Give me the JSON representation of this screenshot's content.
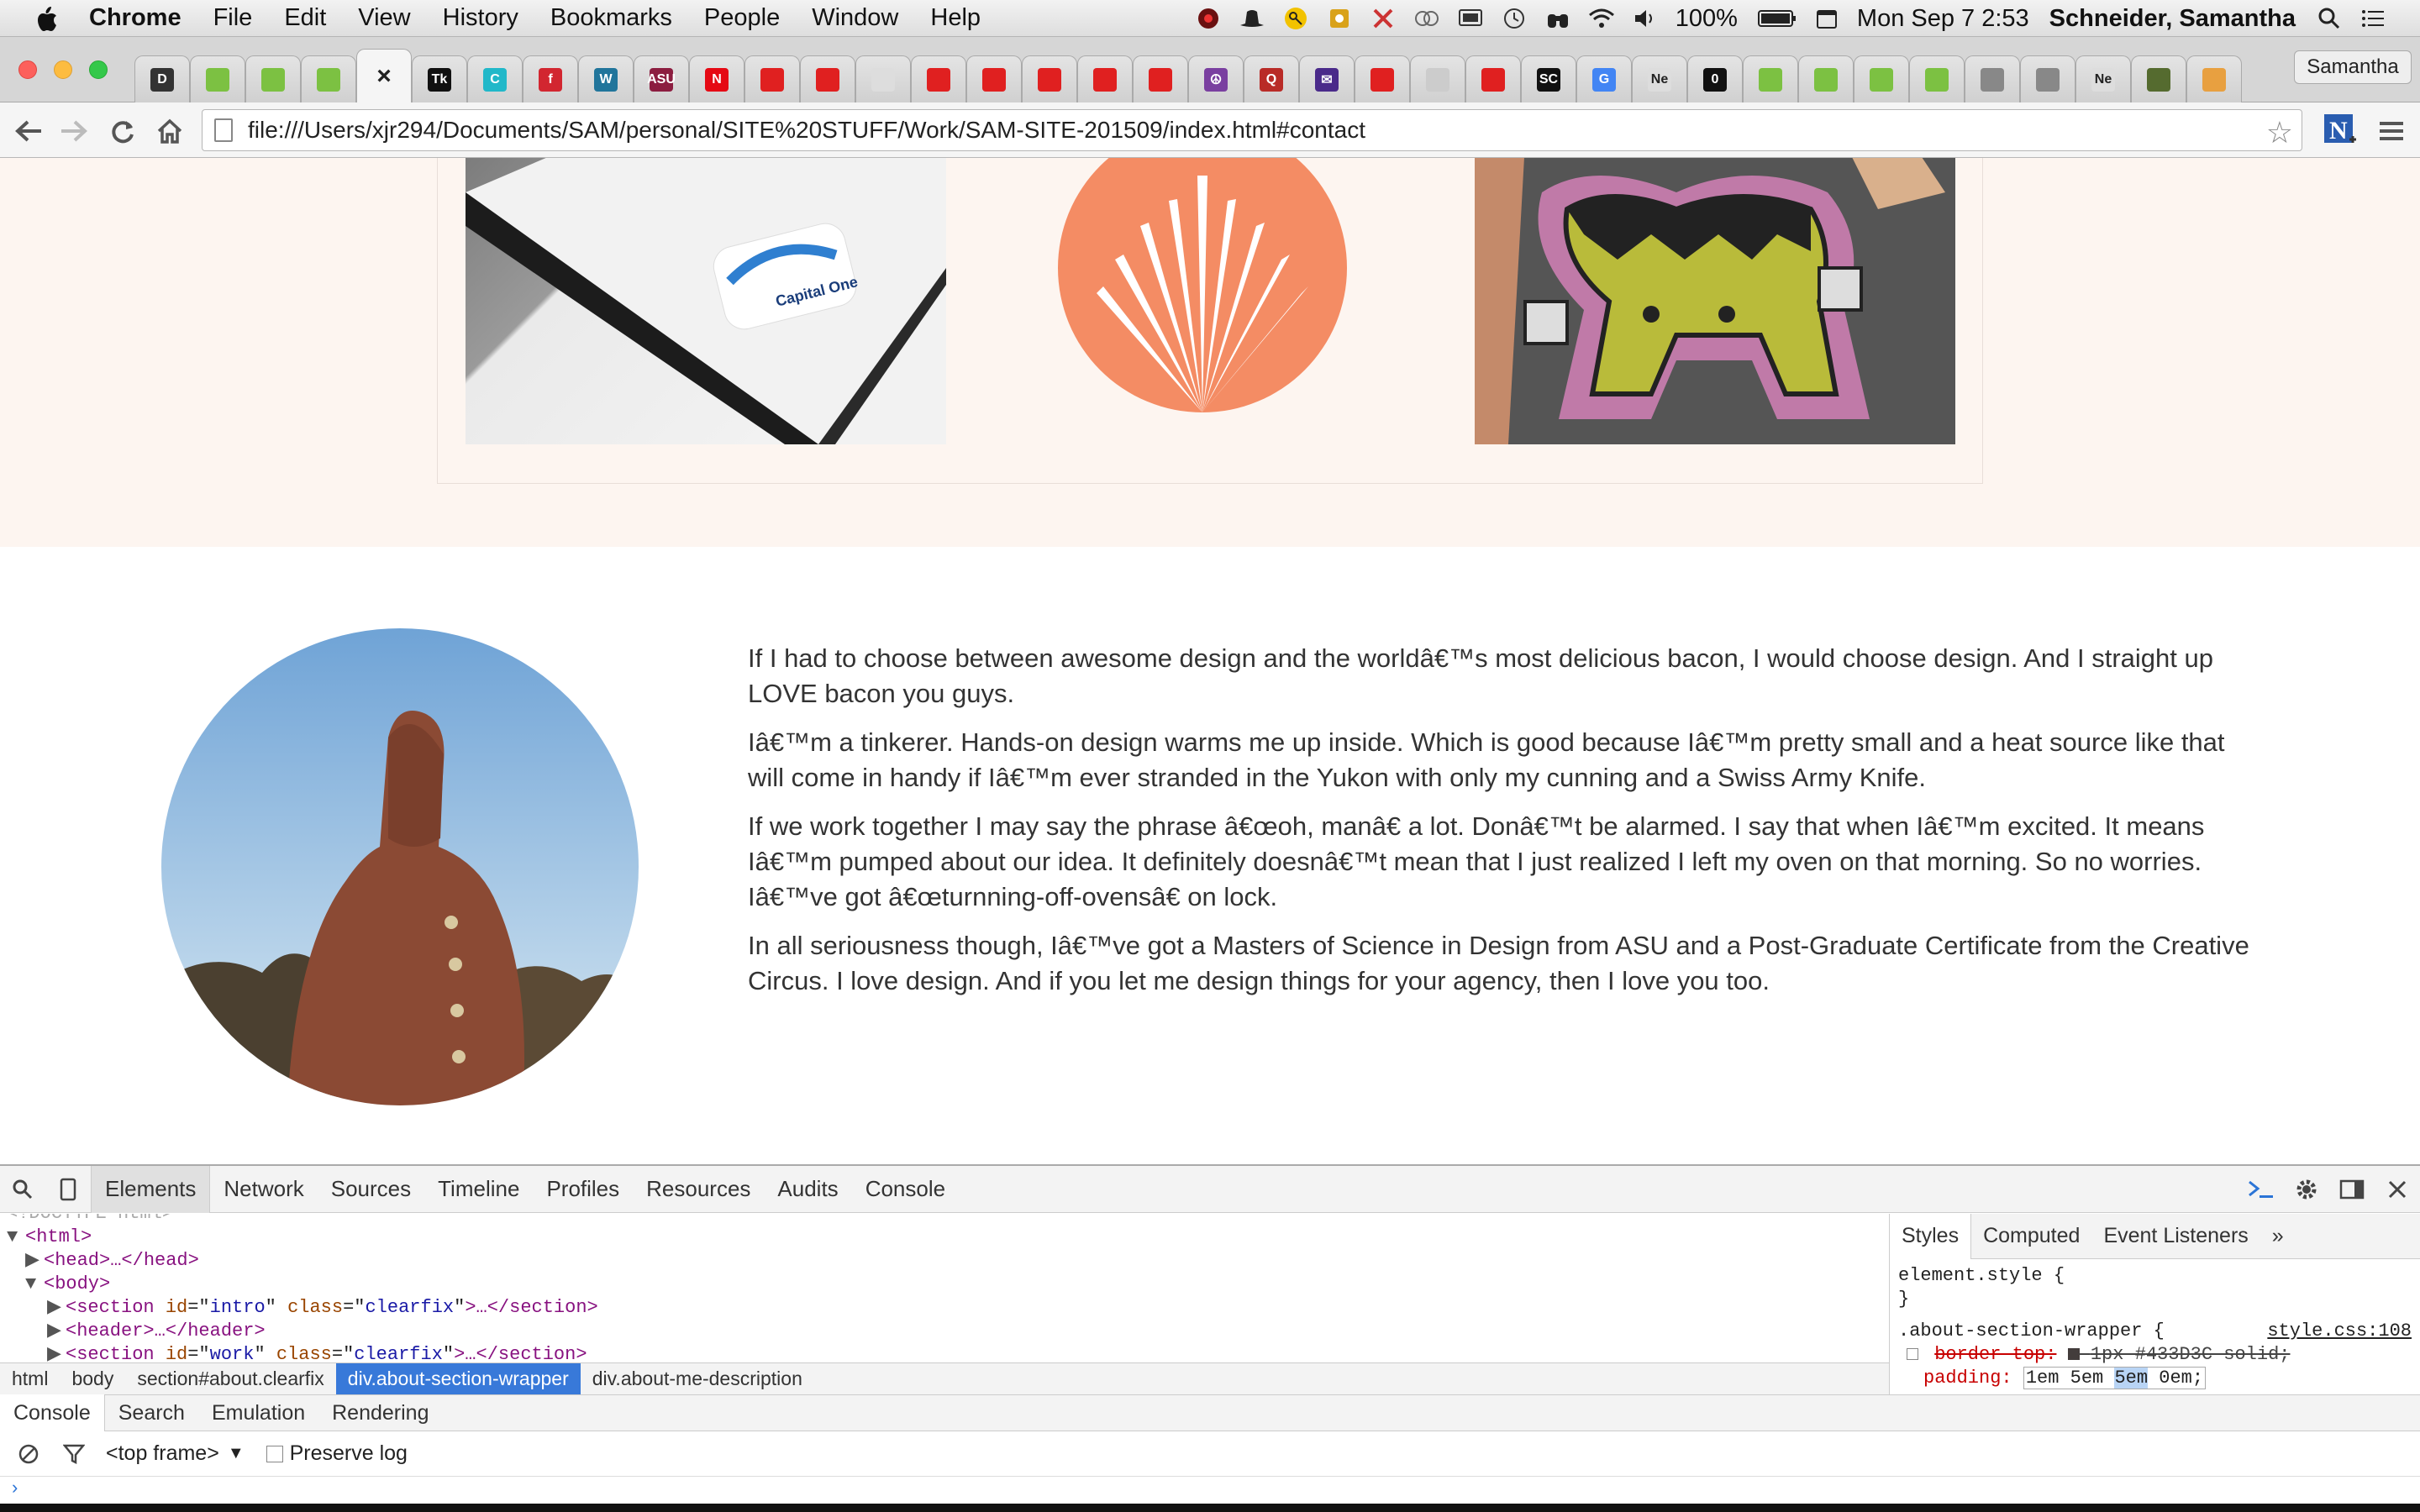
{
  "menubar": {
    "app": "Chrome",
    "items": [
      "File",
      "Edit",
      "View",
      "History",
      "Bookmarks",
      "People",
      "Window",
      "Help"
    ],
    "battery": "100%",
    "datetime": "Mon Sep 7  2:53",
    "user": "Schneider, Samantha"
  },
  "tabs": {
    "favicons": [
      {
        "label": "D",
        "color": "#333333"
      },
      {
        "label": "",
        "color": "#7cc142"
      },
      {
        "label": "",
        "color": "#7cc142"
      },
      {
        "label": "",
        "color": "#7cc142"
      },
      {
        "label": "×",
        "color": "#f5f5f5",
        "active": true
      },
      {
        "label": "Tk",
        "color": "#111111"
      },
      {
        "label": "C",
        "color": "#21b8c9"
      },
      {
        "label": "f",
        "color": "#d22630"
      },
      {
        "label": "W",
        "color": "#21759b"
      },
      {
        "label": "ASU",
        "color": "#8c1d40"
      },
      {
        "label": "N",
        "color": "#e50914"
      },
      {
        "label": "",
        "color": "#e02020"
      },
      {
        "label": "",
        "color": "#e02020"
      },
      {
        "label": "",
        "color": "#dddddd"
      },
      {
        "label": "",
        "color": "#e02020"
      },
      {
        "label": "",
        "color": "#e02020"
      },
      {
        "label": "",
        "color": "#e02020"
      },
      {
        "label": "",
        "color": "#e02020"
      },
      {
        "label": "",
        "color": "#e02020"
      },
      {
        "label": "☮",
        "color": "#7a3fa0"
      },
      {
        "label": "Q",
        "color": "#b92b27"
      },
      {
        "label": "✉",
        "color": "#4a2a8a"
      },
      {
        "label": "",
        "color": "#e02020"
      },
      {
        "label": "",
        "color": "#cccccc"
      },
      {
        "label": "",
        "color": "#e02020"
      },
      {
        "label": "SC",
        "color": "#111111"
      },
      {
        "label": "G",
        "color": "#4285f4"
      },
      {
        "label": "Ne",
        "color": "#dddddd"
      },
      {
        "label": "0",
        "color": "#111111"
      },
      {
        "label": "",
        "color": "#7cc142"
      },
      {
        "label": "",
        "color": "#7cc142"
      },
      {
        "label": "",
        "color": "#7cc142"
      },
      {
        "label": "",
        "color": "#7cc142"
      },
      {
        "label": "",
        "color": "#888888"
      },
      {
        "label": "",
        "color": "#888888"
      },
      {
        "label": "Ne",
        "color": "#dddddd"
      },
      {
        "label": "",
        "color": "#556b2f"
      },
      {
        "label": "",
        "color": "#e8a040"
      }
    ],
    "profile": "Samantha"
  },
  "toolbar": {
    "url": "file:///Users/xjr294/Documents/SAM/personal/SITE%20STUFF/Work/SAM-SITE-201509/index.html#contact"
  },
  "about": {
    "paragraphs": [
      "If I had to choose between awesome design and the worldâ€™s most delicious bacon, I would choose design. And I straight up LOVE bacon you guys.",
      "Iâ€™m a tinkerer. Hands-on design warms me up inside. Which is good because Iâ€™m pretty small and a heat source like that will come in handy if Iâ€™m ever stranded in the Yukon with only my cunning and a Swiss Army Knife.",
      "If we work together I may say the phrase â€œoh, manâ€ a lot. Donâ€™t be alarmed. I say that when Iâ€™m excited. It means Iâ€™m pumped about our idea. It definitely doesnâ€™t mean that I just realized I left my oven on that morning. So no worries. Iâ€™ve got â€œturnning-off-ovensâ€ on lock.",
      "In all seriousness though, Iâ€™ve got a Masters of Science in Design from ASU and a Post-Graduate Certificate from the Creative Circus. I love design. And if you let me design things for your agency, then I love you too."
    ],
    "thumb1_logo": "Capital One"
  },
  "devtools": {
    "tabs": [
      "Elements",
      "Network",
      "Sources",
      "Timeline",
      "Profiles",
      "Resources",
      "Audits",
      "Console"
    ],
    "dom": {
      "doctype": "<!DOCTYPE html>",
      "html_open": "<html>",
      "head": "<head>…</head>",
      "body_open": "<body>",
      "intro_tag": "section",
      "intro_id": "intro",
      "intro_class": "clearfix",
      "header": "<header>…</header>",
      "work_tag": "section",
      "work_id": "work",
      "work_class": "clearfix"
    },
    "crumbs": [
      "html",
      "body",
      "section#about.clearfix",
      "div.about-section-wrapper",
      "div.about-me-description"
    ],
    "styles_tabs": [
      "Styles",
      "Computed",
      "Event Listeners",
      "»"
    ],
    "rules": {
      "element_style": "element.style {",
      "close": "}",
      "selector": ".about-section-wrapper {",
      "source": "style.css:108",
      "border_prop": "border-top:",
      "border_val": "1px  #433D3C solid;",
      "padding_prop": "padding:",
      "padding_val_a": "1em 5em ",
      "padding_val_sel": "5em",
      "padding_val_b": " 0em;"
    },
    "drawer_tabs": [
      "Console",
      "Search",
      "Emulation",
      "Rendering"
    ],
    "console": {
      "frame": "<top frame>",
      "preserve_log": "Preserve log"
    }
  }
}
